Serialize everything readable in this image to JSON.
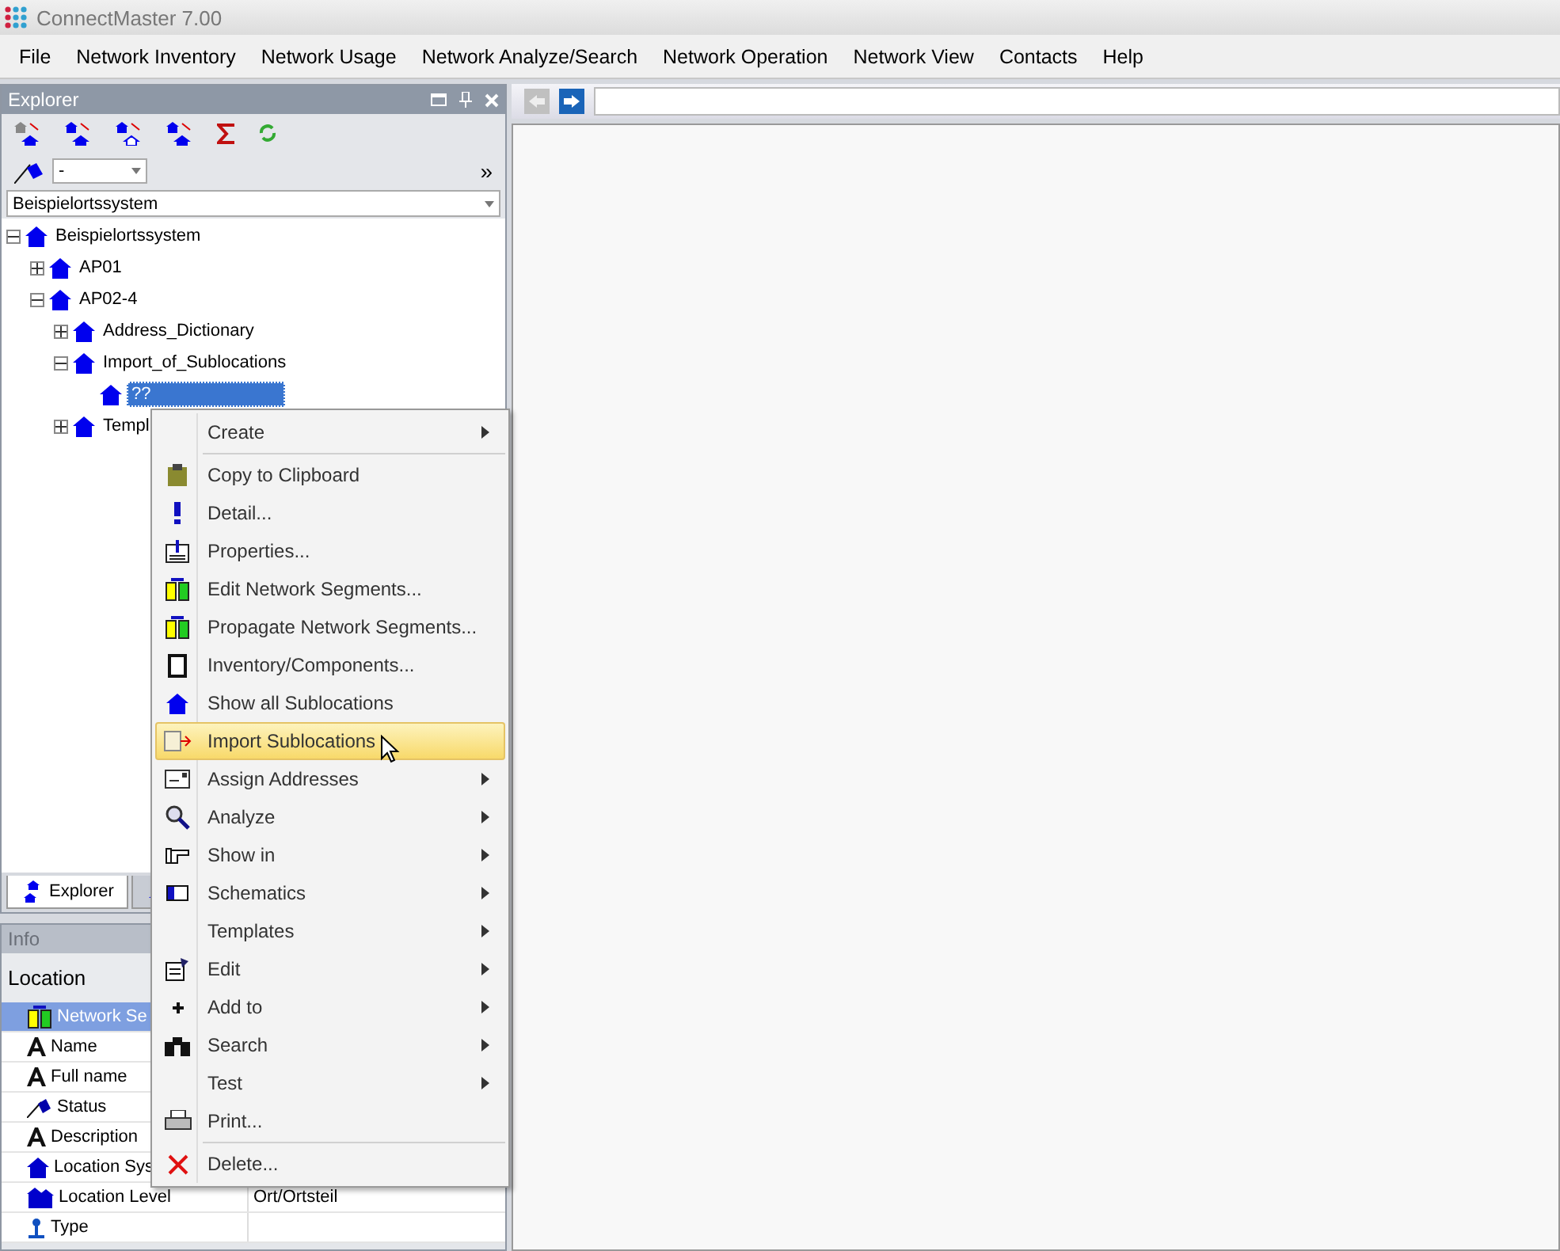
{
  "window": {
    "title": "ConnectMaster 7.00"
  },
  "menu_bar": [
    "File",
    "Network Inventory",
    "Network Usage",
    "Network Analyze/Search",
    "Network Operation",
    "Network View",
    "Contacts",
    "Help"
  ],
  "explorer": {
    "title": "Explorer",
    "filter": {
      "value": "-"
    },
    "more": "»",
    "location_system": "Beispielortssystem",
    "tree": [
      {
        "label": "Beispielortssystem",
        "expanded": true,
        "selected": false,
        "children": [
          {
            "label": "AP01",
            "expanded": false,
            "selected": false
          },
          {
            "label": "AP02-4",
            "expanded": true,
            "selected": false,
            "children": [
              {
                "label": "Address_Dictionary",
                "expanded": false,
                "selected": false
              },
              {
                "label": "Import_of_Sublocations",
                "expanded": true,
                "selected": false,
                "children": [
                  {
                    "label": "??",
                    "selected": true
                  }
                ]
              },
              {
                "label": "Templ",
                "expanded": false,
                "selected": false
              }
            ]
          }
        ]
      }
    ]
  },
  "bottom_tabs": [
    {
      "label": "Explorer",
      "selected": true
    },
    {
      "selected": false
    }
  ],
  "info": {
    "title": "Info",
    "heading": "Location",
    "rows": [
      {
        "label": "Network Se",
        "selected": true
      },
      {
        "label": "Name",
        "selected": false
      },
      {
        "label": "Full name",
        "selected": false
      },
      {
        "label": "Status",
        "selected": false
      },
      {
        "label": "Description",
        "selected": false
      },
      {
        "label": "Location Sys",
        "selected": false
      },
      {
        "label": "Location Level",
        "value": "Ort/Ortsteil",
        "selected": false
      },
      {
        "label": "Type",
        "selected": false
      }
    ]
  },
  "context_menu": [
    {
      "kind": "item",
      "label": "Create",
      "submenu": true,
      "highlighted": false
    },
    {
      "kind": "separator"
    },
    {
      "kind": "item",
      "label": "Copy to Clipboard",
      "submenu": false,
      "highlighted": false
    },
    {
      "kind": "item",
      "label": "Detail...",
      "submenu": false,
      "highlighted": false
    },
    {
      "kind": "item",
      "label": "Properties...",
      "submenu": false,
      "highlighted": false
    },
    {
      "kind": "item",
      "label": "Edit Network Segments...",
      "submenu": false,
      "highlighted": false
    },
    {
      "kind": "item",
      "label": "Propagate Network Segments...",
      "submenu": false,
      "highlighted": false
    },
    {
      "kind": "item",
      "label": "Inventory/Components...",
      "submenu": false,
      "highlighted": false
    },
    {
      "kind": "item",
      "label": "Show all Sublocations",
      "submenu": false,
      "highlighted": false
    },
    {
      "kind": "item",
      "label": "Import Sublocations",
      "submenu": false,
      "highlighted": true
    },
    {
      "kind": "item",
      "label": "Assign Addresses",
      "submenu": true,
      "highlighted": false
    },
    {
      "kind": "item",
      "label": "Analyze",
      "submenu": true,
      "highlighted": false
    },
    {
      "kind": "item",
      "label": "Show in",
      "submenu": true,
      "highlighted": false
    },
    {
      "kind": "item",
      "label": "Schematics",
      "submenu": true,
      "highlighted": false
    },
    {
      "kind": "item",
      "label": "Templates",
      "submenu": true,
      "highlighted": false
    },
    {
      "kind": "item",
      "label": "Edit",
      "submenu": true,
      "highlighted": false
    },
    {
      "kind": "item",
      "label": "Add to",
      "submenu": true,
      "highlighted": false
    },
    {
      "kind": "item",
      "label": "Search",
      "submenu": true,
      "highlighted": false
    },
    {
      "kind": "item",
      "label": "Test",
      "submenu": true,
      "highlighted": false
    },
    {
      "kind": "item",
      "label": "Print...",
      "submenu": false,
      "highlighted": false
    },
    {
      "kind": "separator"
    },
    {
      "kind": "item",
      "label": "Delete...",
      "submenu": false,
      "highlighted": false
    }
  ]
}
